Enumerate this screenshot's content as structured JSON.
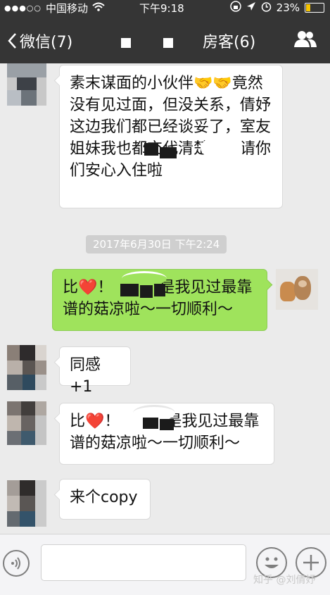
{
  "status_bar": {
    "signal": "●●●○○",
    "carrier": "中国移动",
    "time": "下午9:18",
    "battery_pct": "23%",
    "battery_level": 0.23
  },
  "nav": {
    "back_label": "微信(7)",
    "title": "房客(6)"
  },
  "messages": [
    {
      "sender": "other",
      "text": "素末谋面的小伙伴🤝🤝竟然没有见过面，但没关系，倩妤这边我们都已经谈妥了，室友姐妹我也都交代清楚了，请你们安心入住啦"
    },
    {
      "sender": "self",
      "text": "比❤️！　　　是我见过最靠谱的菇凉啦～一切顺利～"
    },
    {
      "sender": "other",
      "text": "同感+1"
    },
    {
      "sender": "other",
      "text": "比❤️！　　　是我见过最靠谱的菇凉啦～一切顺利～"
    },
    {
      "sender": "other",
      "text": "来个copy"
    }
  ],
  "timestamp": "2017年6月30日 下午2:24",
  "watermark": "知乎 @刘倩妤",
  "icons": {
    "back": "chevron-left-icon",
    "members": "group-icon",
    "voice": "voice-icon",
    "emoji": "emoji-icon",
    "plus": "plus-icon"
  },
  "colors": {
    "nav_bg": "#353535",
    "chat_bg": "#ebebeb",
    "outgoing_bubble": "#9fe35c"
  }
}
